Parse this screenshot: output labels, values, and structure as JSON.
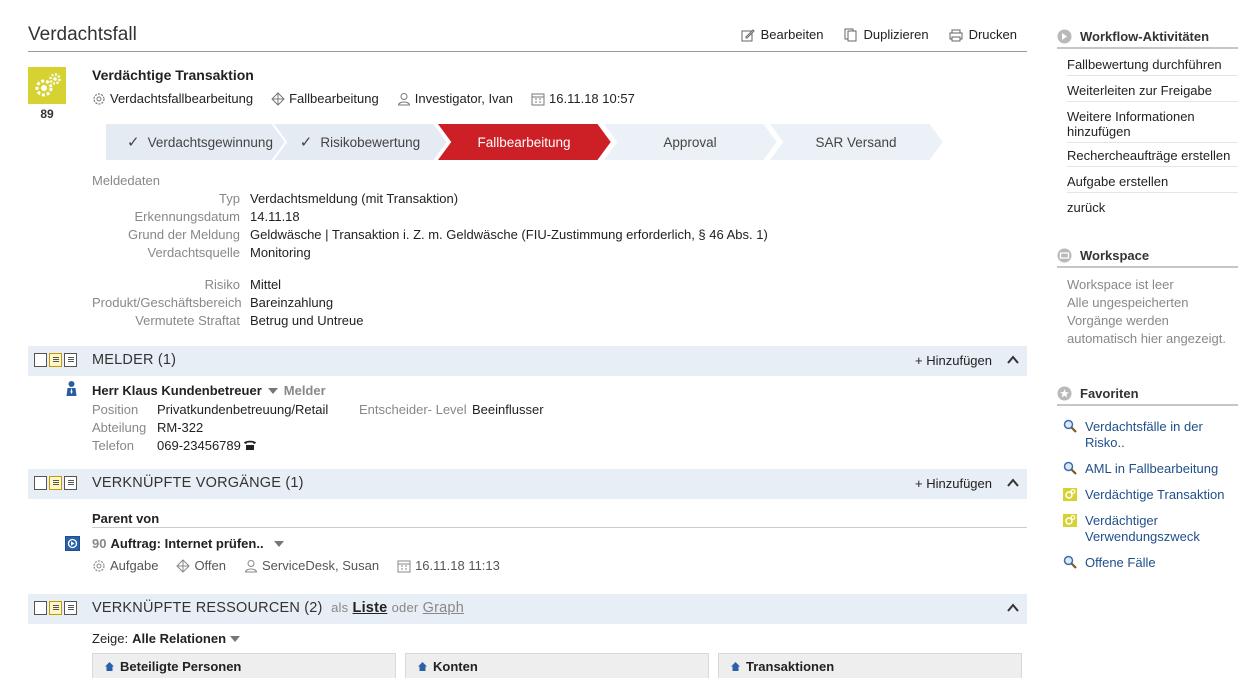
{
  "header": {
    "title": "Verdachtsfall",
    "actions": {
      "edit": "Bearbeiten",
      "duplicate": "Duplizieren",
      "print": "Drucken"
    }
  },
  "case": {
    "number": "89",
    "title": "Verdächtige Transaktion",
    "type": "Verdachtsfallbearbeitung",
    "phase": "Fallbearbeitung",
    "assignee": "Investigator, Ivan",
    "date": "16.11.18 10:57"
  },
  "progress": {
    "steps": [
      {
        "label": "Verdachtsgewinnung",
        "done": true
      },
      {
        "label": "Risikobewertung",
        "done": true
      },
      {
        "label": "Fallbearbeitung",
        "active": true
      },
      {
        "label": "Approval"
      },
      {
        "label": "SAR Versand"
      }
    ],
    "colors": {
      "done": "#e4ebf3",
      "active": "#cc1f26",
      "pending": "#ecf1f7"
    }
  },
  "details": {
    "section_label": "Meldedaten",
    "rows1": [
      {
        "k": "Typ",
        "v": "Verdachtsmeldung (mit Transaktion)"
      },
      {
        "k": "Erkennungsdatum",
        "v": "14.11.18"
      },
      {
        "k": "Grund der Meldung",
        "v": "Geldwäsche | Transaktion i. Z. m. Geldwäsche (FIU-Zustimmung erforderlich, § 46 Abs. 1)"
      },
      {
        "k": "Verdachtsquelle",
        "v": "Monitoring"
      }
    ],
    "rows2": [
      {
        "k": "Risiko",
        "v": "Mittel"
      },
      {
        "k": "Produkt/Geschäftsbereich",
        "v": "Bareinzahlung"
      },
      {
        "k": "Vermutete Straftat",
        "v": "Betrug und Untreue"
      }
    ]
  },
  "melder": {
    "title": "MELDER (1)",
    "add": "Hinzufügen",
    "name": "Herr Klaus Kundenbetreuer",
    "role": "Melder",
    "position_label": "Position",
    "position": "Privatkundenbetreuung/Retail",
    "level_label": "Entscheider- Level",
    "level": "Beeinflusser",
    "department_label": "Abteilung",
    "department": "RM-322",
    "phone_label": "Telefon",
    "phone": "069-23456789"
  },
  "linked": {
    "title": "VERKNÜPFTE VORGÄNGE (1)",
    "add": "Hinzufügen",
    "sub": "Parent von",
    "task": {
      "num": "90",
      "title": "Auftrag: Internet prüfen..",
      "type": "Aufgabe",
      "status": "Offen",
      "assignee": "ServiceDesk, Susan",
      "date": "16.11.18 11:13"
    }
  },
  "resources": {
    "title": "VERKNÜPFTE RESSOURCEN (2)",
    "as": "als",
    "list": "Liste",
    "or": "oder",
    "graph": "Graph",
    "show_label": "Zeige:",
    "show_value": "Alle Relationen",
    "columns": [
      "Beteiligte Personen",
      "Konten",
      "Transaktionen"
    ]
  },
  "sidebar": {
    "workflow": {
      "title": "Workflow-Aktivitäten",
      "items": [
        "Fallbewertung durchführen",
        "Weiterleiten zur Freigabe",
        "Weitere Informationen hinzufügen",
        "Rechercheaufträge erstellen",
        "Aufgabe erstellen",
        "zurück"
      ]
    },
    "workspace": {
      "title": "Workspace",
      "empty": "Workspace ist leer",
      "note": "Alle ungespeicherten Vorgänge werden automatisch hier angezeigt."
    },
    "favorites": {
      "title": "Favoriten",
      "items": [
        {
          "label": "Verdachtsfälle in der Risko..",
          "icon": "search-icon"
        },
        {
          "label": "AML in Fallbearbeitung",
          "icon": "search-icon"
        },
        {
          "label": "Verdächtige Transaktion",
          "icon": "case-icon"
        },
        {
          "label": "Verdächtiger Verwendungszweck",
          "icon": "case-icon"
        },
        {
          "label": "Offene Fälle",
          "icon": "search-icon"
        }
      ]
    }
  }
}
